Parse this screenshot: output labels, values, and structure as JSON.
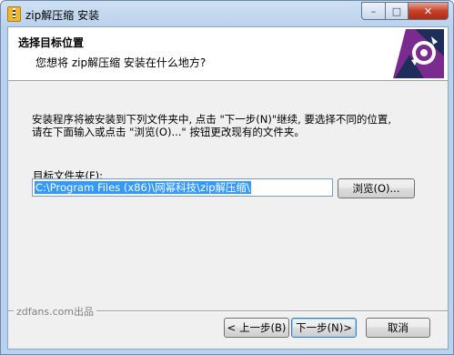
{
  "window": {
    "title": "zip解压缩 安装",
    "caption": {
      "minimize": "–",
      "maximize": "□",
      "close": "✕"
    }
  },
  "header": {
    "title": "选择目标位置",
    "subtitle": "您想将 zip解压缩 安装在什么地方?"
  },
  "body": {
    "line1": "安装程序将被安装到下列文件夹中, 点击 \"下一步(N)\"继续, 要选择不同的位置,",
    "line2": "请在下面输入或点击 \"浏览(O)...\" 按钮更改现有的文件夹。"
  },
  "destination": {
    "label": "目标文件夹(F):",
    "value": "C:\\Program Files (x86)\\网幂科技\\zip解压缩\\",
    "browse_label": "浏览(O)..."
  },
  "footer": {
    "brand": "zdfans.com出品",
    "back_label": "< 上一步(B)",
    "next_label": "下一步(N)>",
    "cancel_label": "取消"
  },
  "colors": {
    "selection": "#3399ff",
    "titlebar": "#b9d1ec",
    "logo_purple": "#7b2a8f",
    "logo_navy": "#1f2d5a"
  }
}
